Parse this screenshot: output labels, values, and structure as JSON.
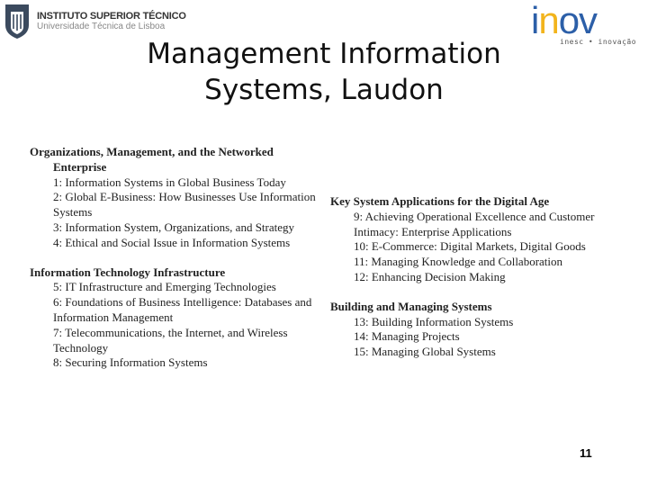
{
  "logos": {
    "left": {
      "name": "INSTITUTO SUPERIOR TÉCNICO",
      "subtitle": "Universidade Técnica de Lisboa",
      "shield_color": "#3b4a5e"
    },
    "right": {
      "word_i": "i",
      "word_n": "n",
      "word_ov": "ov",
      "tagline": "inesc • inovação",
      "blue": "#2c5fa8",
      "yellow": "#f2b41c"
    }
  },
  "title": {
    "line1": "Management Information",
    "line2": "Systems, Laudon"
  },
  "left_column": [
    {
      "heading_line1": "Organizations, Management, and the Networked",
      "heading_line2": "Enterprise",
      "items": [
        "1: Information Systems in Global Business Today",
        "2: Global E-Business: How Businesses Use Information Systems",
        "3: Information System, Organizations, and Strategy",
        "4: Ethical and Social Issue in Information Systems"
      ]
    },
    {
      "heading_line1": "Information Technology Infrastructure",
      "items": [
        "5: IT Infrastructure and Emerging Technologies",
        "6: Foundations of Business Intelligence: Databases and Information Management",
        "7: Telecommunications, the Internet, and Wireless Technology",
        "8: Securing Information Systems"
      ]
    }
  ],
  "right_column": [
    {
      "heading_line1": "Key System Applications for the Digital Age",
      "items": [
        "9: Achieving Operational Excellence and Customer Intimacy: Enterprise Applications",
        "10: E-Commerce: Digital Markets, Digital Goods",
        "11: Managing Knowledge and Collaboration",
        "12: Enhancing Decision Making"
      ]
    },
    {
      "heading_line1": "Building and Managing Systems",
      "items": [
        "13: Building Information Systems",
        "14: Managing Projects",
        "15: Managing Global Systems"
      ]
    }
  ],
  "page_number": "11"
}
